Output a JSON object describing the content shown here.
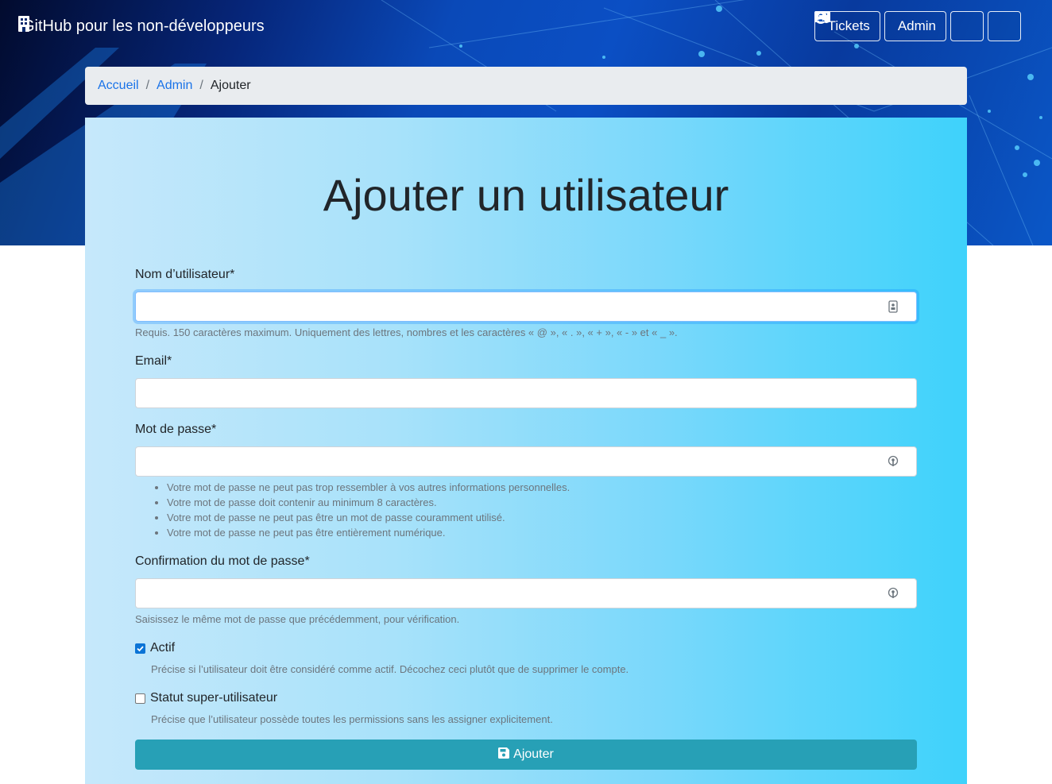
{
  "navbar": {
    "brand": "GitHub pour les non-développeurs",
    "tickets_label": "Tickets",
    "admin_label": "Admin"
  },
  "breadcrumb": {
    "home": "Accueil",
    "admin": "Admin",
    "current": "Ajouter"
  },
  "form": {
    "title": "Ajouter un utilisateur",
    "username": {
      "label": "Nom d’utilisateur*",
      "value": "",
      "help": "Requis. 150 caractères maximum. Uniquement des lettres, nombres et les caractères « @ », « . », « + », « - » et « _ »."
    },
    "email": {
      "label": "Email*",
      "value": ""
    },
    "password": {
      "label": "Mot de passe*",
      "value": "",
      "help": [
        "Votre mot de passe ne peut pas trop ressembler à vos autres informations personnelles.",
        "Votre mot de passe doit contenir au minimum 8 caractères.",
        "Votre mot de passe ne peut pas être un mot de passe couramment utilisé.",
        "Votre mot de passe ne peut pas être entièrement numérique."
      ]
    },
    "password_confirm": {
      "label": "Confirmation du mot de passe*",
      "value": "",
      "help": "Saisissez le même mot de passe que précédemment, pour vérification."
    },
    "active": {
      "label": "Actif",
      "checked": true,
      "help": "Précise si l’utilisateur doit être considéré comme actif. Décochez ceci plutôt que de supprimer le compte."
    },
    "superuser": {
      "label": "Statut super-utilisateur",
      "checked": false,
      "help": "Précise que l’utilisateur possède toutes les permissions sans les assigner explicitement."
    },
    "submit_label": "Ajouter"
  },
  "colors": {
    "submit_button": "#27a0b6",
    "link": "#1a73e8",
    "checkbox_checked": "#0b74d6"
  }
}
